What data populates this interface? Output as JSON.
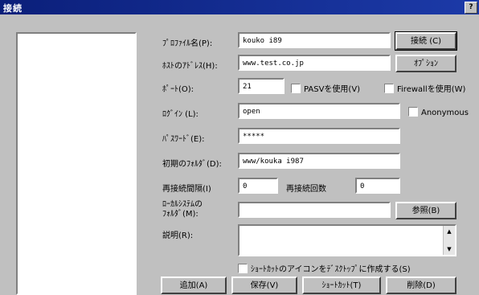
{
  "window": {
    "title": "接続",
    "help_glyph": "?"
  },
  "labels": {
    "profile": "ﾌﾟﾛﾌｧｲﾙ名(P):",
    "host": "ﾎｽﾄのｱﾄﾞﾚｽ(H):",
    "port": "ﾎﾟｰﾄ(O):",
    "login": "ﾛｸﾞｲﾝ (L):",
    "password": "ﾊﾟｽﾜｰﾄﾞ(E):",
    "initdir": "初期のﾌｫﾙﾀﾞ(D):",
    "retry_wait": "再接続間隔(I)",
    "retry_count": "再接続回数",
    "local_dir": "ﾛｰｶﾙｼｽﾃﾑの\nﾌｫﾙﾀﾞ(M):",
    "desc": "説明(R):"
  },
  "values": {
    "profile": "kouko i89",
    "host": "www.test.co.jp",
    "port": "21",
    "login": "open",
    "password": "*****",
    "initdir": "www/kouka i987",
    "retry_wait": "0",
    "retry_count": "0",
    "local_dir": "",
    "desc": ""
  },
  "checkboxes": {
    "pasv": "PASVを使用(V)",
    "firewall": "Firewallを使用(W)",
    "anonymous": "Anonymous",
    "shortcut": "ｼｮｰﾄｶｯﾄのアイコンをﾃﾞｽｸﾄｯﾌﾟに作成する(S)"
  },
  "buttons": {
    "connect": "接続 (C)",
    "option": "ｵﾌﾟｼｮﾝ",
    "browse": "参照(B)",
    "add": "追加(A)",
    "save": "保存(V)",
    "shortcut": "ｼｮｰﾄｶｯﾄ(T)",
    "delete": "削除(D)"
  }
}
